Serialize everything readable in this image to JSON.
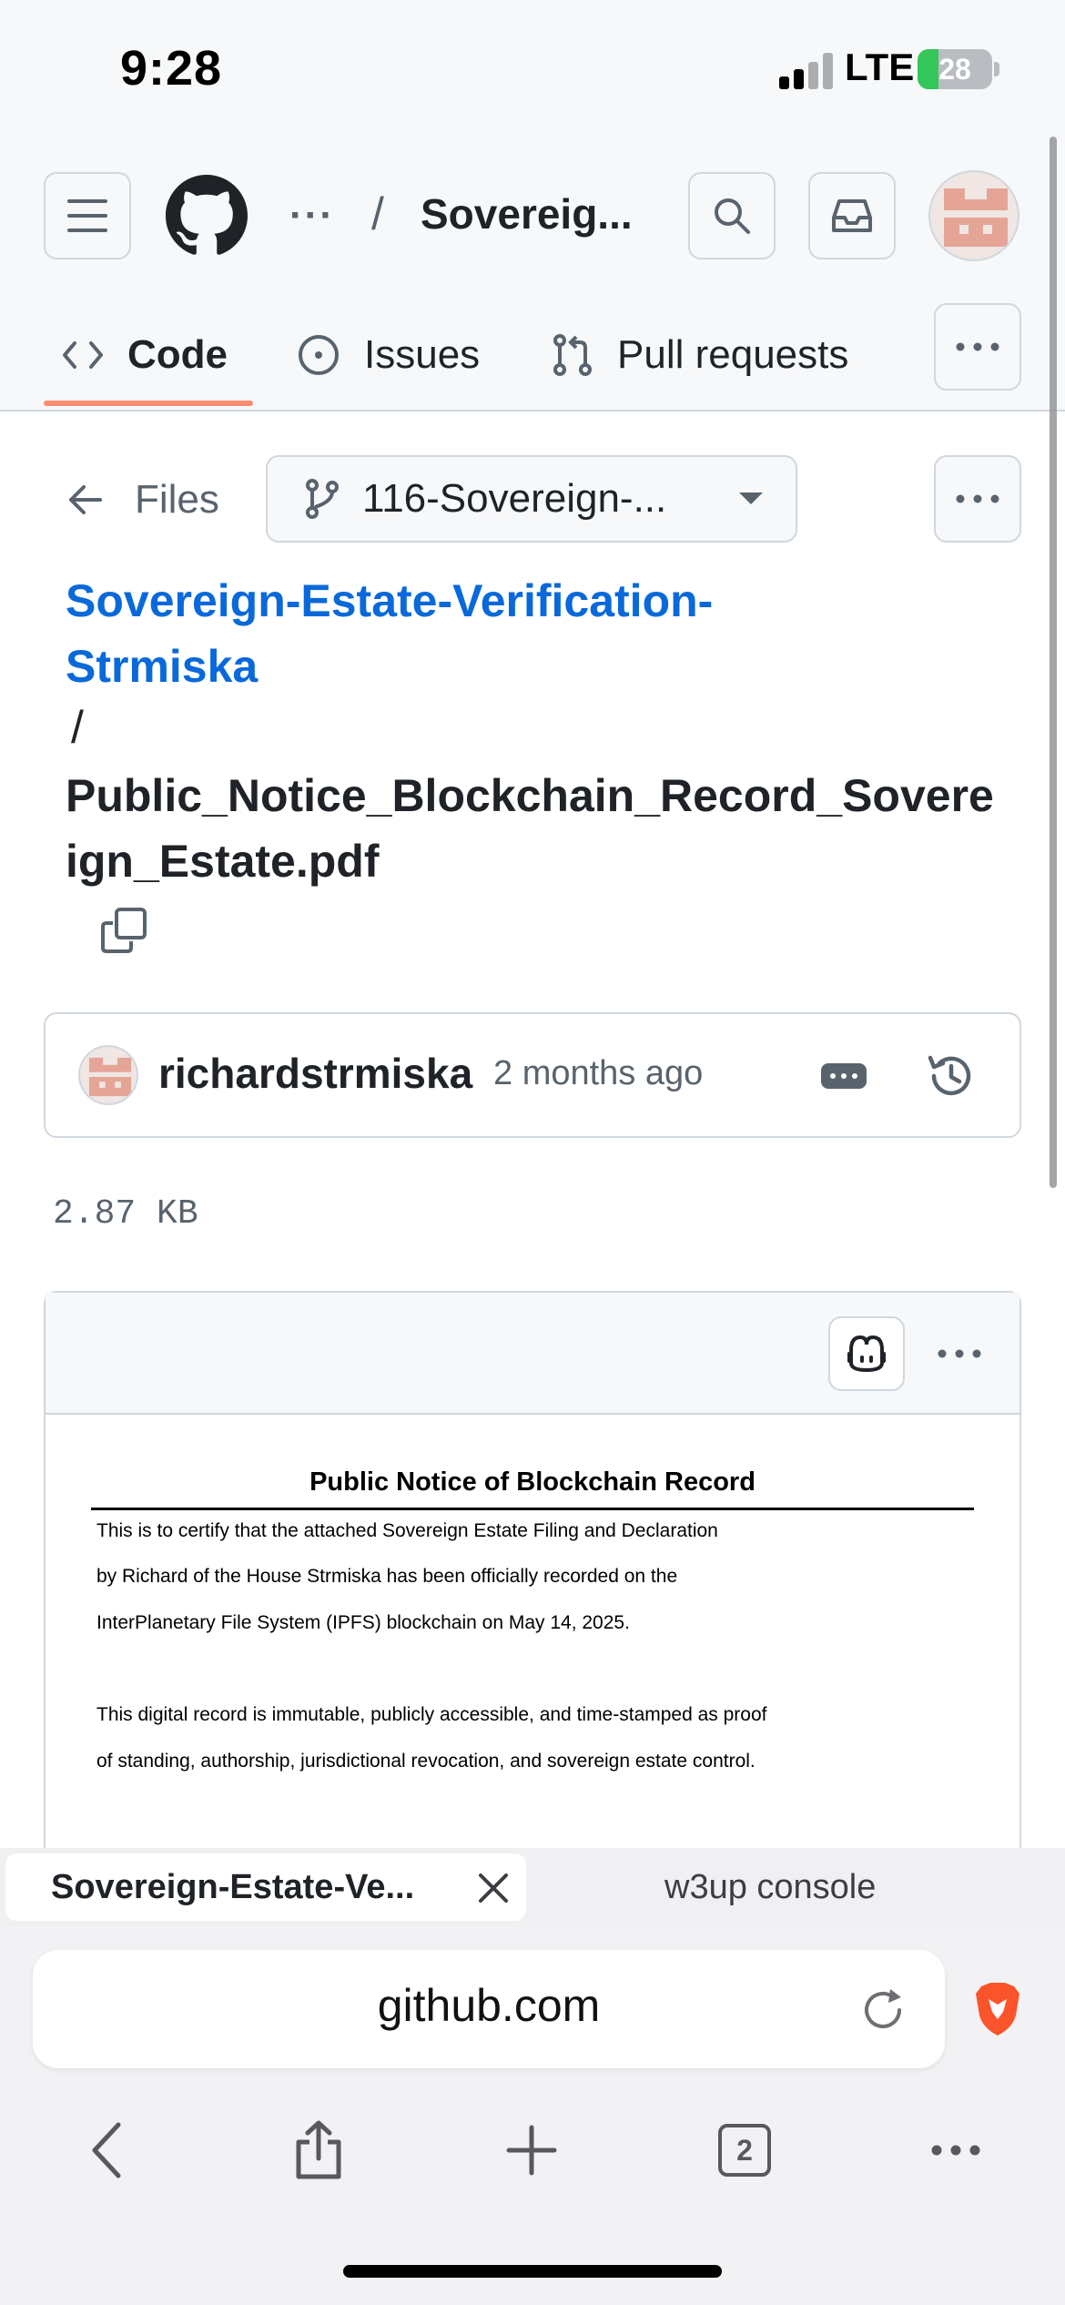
{
  "status_bar": {
    "time": "9:28",
    "network": "LTE",
    "battery": "28",
    "battery_fill_fraction": 0.28,
    "signal_icon": "signal-bars-icon",
    "battery_icon": "battery-charging-icon"
  },
  "header": {
    "breadcrumb_ellipsis": "···",
    "breadcrumb_slash": "/",
    "repo_name": "Sovereig...",
    "icons": [
      "hamburger-menu-icon",
      "github-logo-icon",
      "search-icon",
      "inbox-icon",
      "avatar-icon"
    ]
  },
  "tabs": [
    {
      "label": "Code",
      "icon": "code-icon",
      "selected": true
    },
    {
      "label": "Issues",
      "icon": "issue-circle-icon",
      "selected": false
    },
    {
      "label": "Pull requests",
      "icon": "pull-request-icon",
      "selected": false
    }
  ],
  "file": {
    "back_label": "Files",
    "branch": "116-Sovereign-...",
    "repo_link": "Sovereign-Estate-Verification-Strmiska",
    "path_separator": "/",
    "file_name": "Public_Notice_Blockchain_Record_Sovereign_Estate.pdf",
    "size": "2.87 KB"
  },
  "commit": {
    "author": "richardstrmiska",
    "time": "2 months ago"
  },
  "pdf": {
    "title": "Public Notice of Blockchain Record",
    "lines": [
      "This is to certify that the attached Sovereign Estate Filing and Declaration",
      "by Richard of the House Strmiska has been officially recorded on the",
      "InterPlanetary File System (IPFS) blockchain on May 14, 2025.",
      "This digital record is immutable, publicly accessible, and time-stamped as proof",
      "of standing, authorship, jurisdictional revocation, and sovereign estate control."
    ]
  },
  "browser": {
    "active_tab": "Sovereign-Estate-Ve...",
    "inactive_tab": "w3up console",
    "url": "github.com",
    "open_tabs": "2"
  },
  "colors": {
    "link_blue": "#0969da",
    "tab_underline": "#fd8c73",
    "border": "#d0d7de",
    "muted_text": "#59636e",
    "battery_green": "#34c759",
    "brave_orange": "#fb542b"
  }
}
